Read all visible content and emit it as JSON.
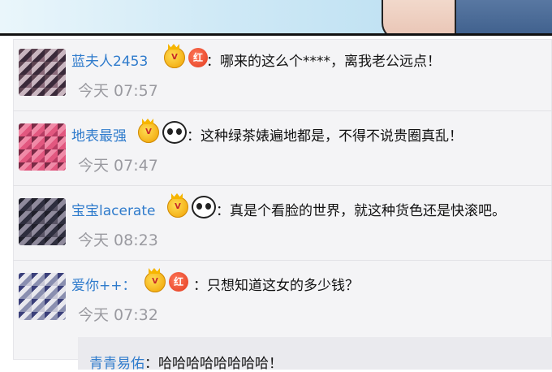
{
  "comments": [
    {
      "username": "蓝夫人2453",
      "separator": "：",
      "text": "哪来的这么个****，离我老公远点！",
      "time": "今天 07:57",
      "badges": [
        "crown",
        "hong"
      ],
      "badge_label_hong": "红",
      "avatar_colors": [
        "#3a2a3a",
        "#8a6a7a",
        "#c9b6c0",
        "#5b4250"
      ]
    },
    {
      "username": "地表最强",
      "separator": "：",
      "text": "这种绿茶婊遍地都是，不得不说贵圈真乱！",
      "time": "今天 07:47",
      "badges": [
        "crown",
        "panda"
      ],
      "avatar_colors": [
        "#e2577f",
        "#b73c63",
        "#f08aa7",
        "#7a2a45"
      ]
    },
    {
      "username": "宝宝lacerate",
      "separator": "：",
      "text": "真是个看脸的世界，就这种货色还是快滚吧。",
      "time": "今天 08:23",
      "badges": [
        "crown",
        "panda"
      ],
      "avatar_colors": [
        "#2e2e3e",
        "#5a5566",
        "#8f8a9c",
        "#1f1f2a"
      ]
    },
    {
      "username": "爱你++",
      "separator": "：",
      "text": "只想知道这女的多少钱？",
      "time": "今天 07:32",
      "badges": [
        "crown",
        "hong"
      ],
      "badge_label_hong": "红",
      "avatar_colors": [
        "#3a3f7a",
        "#c9c9d8",
        "#8a8fb0",
        "#e8e8ee"
      ]
    }
  ],
  "reply": {
    "username": "青青易佑",
    "text": "：哈哈哈哈哈哈哈哈！"
  }
}
